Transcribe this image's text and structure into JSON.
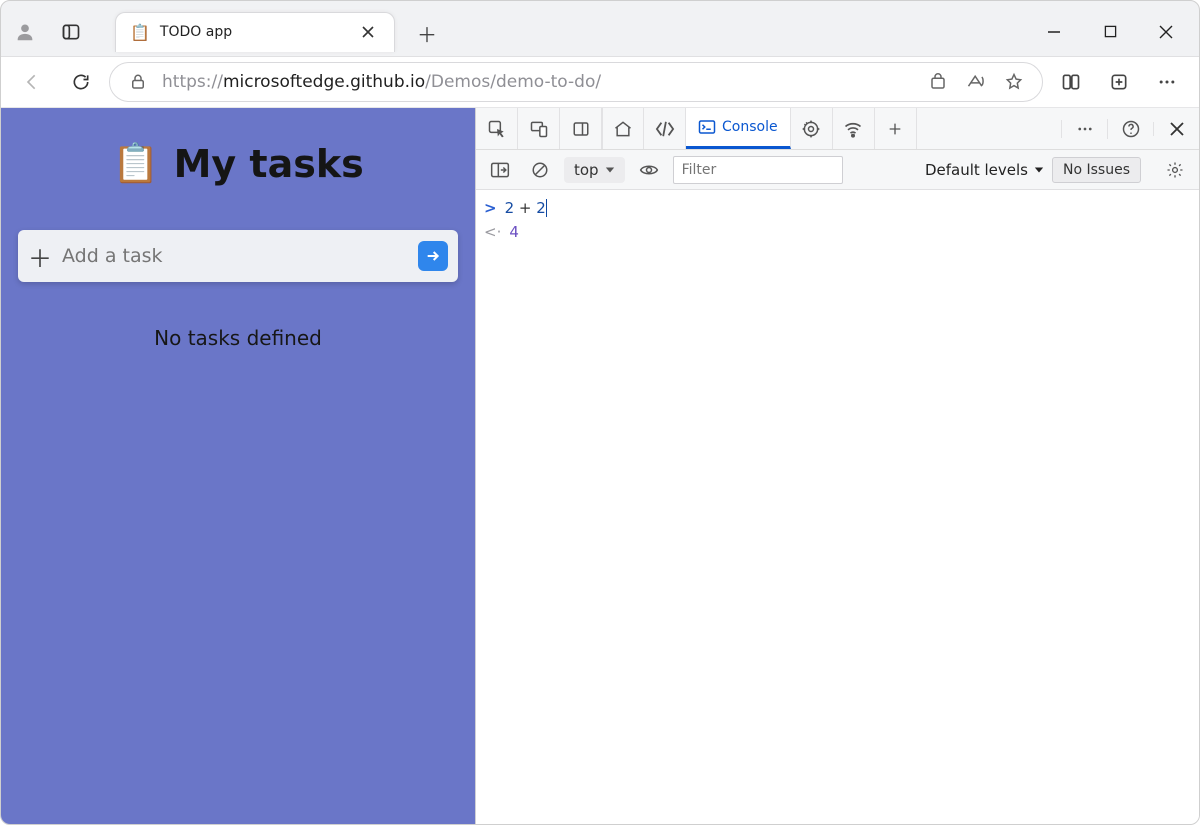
{
  "browser": {
    "tab_title": "TODO app",
    "url_muted_prefix": "https://",
    "url_host": "microsoftedge.github.io",
    "url_path": "/Demos/demo-to-do/"
  },
  "page": {
    "title": "My tasks",
    "add_placeholder": "Add a task",
    "empty_message": "No tasks defined"
  },
  "devtools": {
    "tabs": {
      "console": "Console"
    },
    "toolbar": {
      "context": "top",
      "filter_placeholder": "Filter",
      "levels_label": "Default levels",
      "issues_chip": "No Issues"
    },
    "console": {
      "input": "2 + 2",
      "output": "4"
    }
  }
}
